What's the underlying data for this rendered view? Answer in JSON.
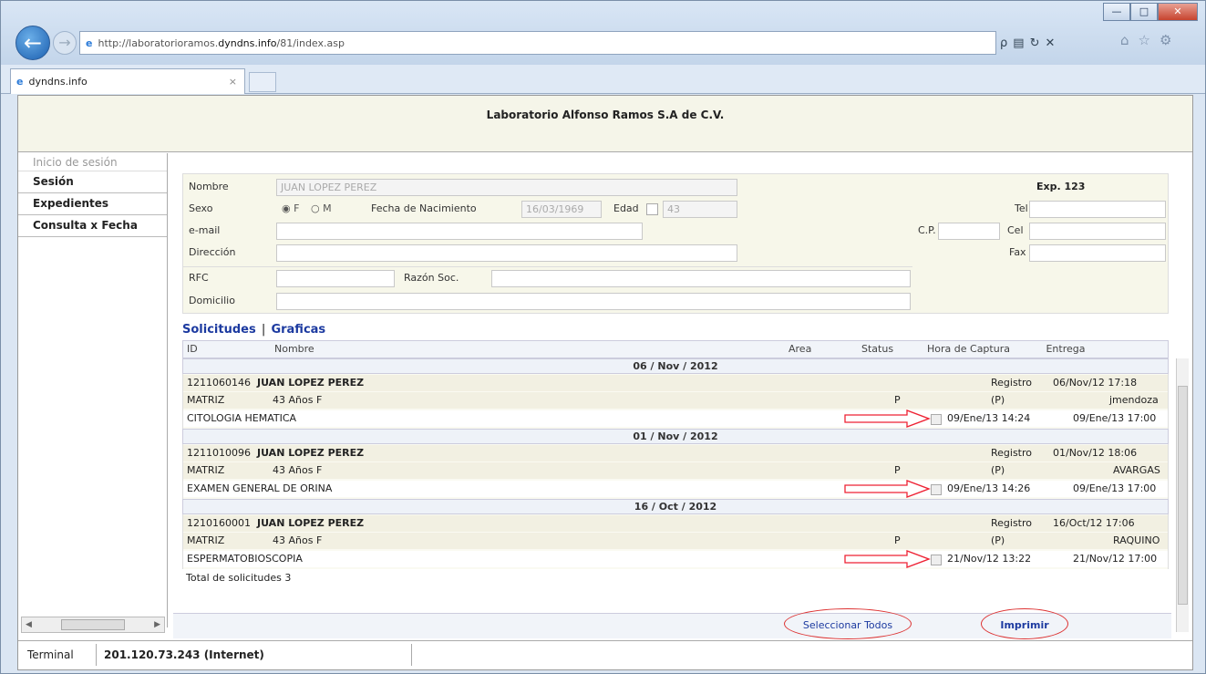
{
  "browser": {
    "url_prefix": "http://laboratorioramos.",
    "url_domain": "dyndns.info",
    "url_suffix": "/81/index.asp",
    "tab_title": "dyndns.info",
    "window_minimize": "—",
    "window_maximize": "□",
    "window_close": "✕",
    "search_symbol": "ρ",
    "refresh_symbol": "↻",
    "stop_symbol": "✕"
  },
  "header": {
    "title": "Laboratorio Alfonso Ramos S.A de C.V."
  },
  "sidebar": {
    "title": "Inicio de sesión",
    "items": [
      {
        "label": "Sesión"
      },
      {
        "label": "Expedientes"
      },
      {
        "label": "Consulta x Fecha"
      }
    ]
  },
  "form": {
    "nombre_label": "Nombre",
    "nombre_value": "JUAN LOPEZ PEREZ",
    "exp": "Exp. 123",
    "sexo_label": "Sexo",
    "sexo_f": "F",
    "sexo_m": "M",
    "fecha_label": "Fecha de Nacimiento",
    "fecha_value": "16/03/1969",
    "edad_label": "Edad",
    "edad_value": "43",
    "tel_label": "Tel",
    "email_label": "e-mail",
    "cp_label": "C.P.",
    "cel_label": "Cel",
    "direccion_label": "Dirección",
    "fax_label": "Fax",
    "rfc_label": "RFC",
    "razon_label": "Razón Soc.",
    "domicilio_label": "Domicilio"
  },
  "tabs": {
    "solicitudes": "Solicitudes",
    "sep": "|",
    "graficas": "Graficas"
  },
  "grid": {
    "headers": [
      "ID",
      "Nombre",
      "Area",
      "Status",
      "Hora de Captura",
      "Entrega"
    ],
    "groups": [
      {
        "date": "06 / Nov / 2012",
        "id": "1211060146",
        "name": "JUAN LOPEZ PEREZ",
        "registro": "Registro",
        "reg_date": "06/Nov/12 17:18",
        "area": "MATRIZ",
        "edad": "43 Años F",
        "status": "P",
        "p": "(P)",
        "user": "jmendoza",
        "study": "CITOLOGIA HEMATICA",
        "captura": "09/Ene/13 14:24",
        "entrega": "09/Ene/13 17:00"
      },
      {
        "date": "01 / Nov / 2012",
        "id": "1211010096",
        "name": "JUAN LOPEZ PEREZ",
        "registro": "Registro",
        "reg_date": "01/Nov/12 18:06",
        "area": "MATRIZ",
        "edad": "43 Años F",
        "status": "P",
        "p": "(P)",
        "user": "AVARGAS",
        "study": "EXAMEN GENERAL DE ORINA",
        "captura": "09/Ene/13 14:26",
        "entrega": "09/Ene/13 17:00"
      },
      {
        "date": "16 / Oct / 2012",
        "id": "1210160001",
        "name": "JUAN LOPEZ PEREZ",
        "registro": "Registro",
        "reg_date": "16/Oct/12 17:06",
        "area": "MATRIZ",
        "edad": "43 Años F",
        "status": "P",
        "p": "(P)",
        "user": "RAQUINO",
        "study": "ESPERMATOBIOSCOPIA",
        "captura": "21/Nov/12 13:22",
        "entrega": "21/Nov/12 17:00"
      }
    ],
    "total": "Total de solicitudes 3"
  },
  "actions": {
    "select_all": "Seleccionar Todos",
    "print": "Imprimir"
  },
  "status": {
    "terminal_label": "Terminal",
    "terminal_value": "201.120.73.243 (Internet)"
  }
}
